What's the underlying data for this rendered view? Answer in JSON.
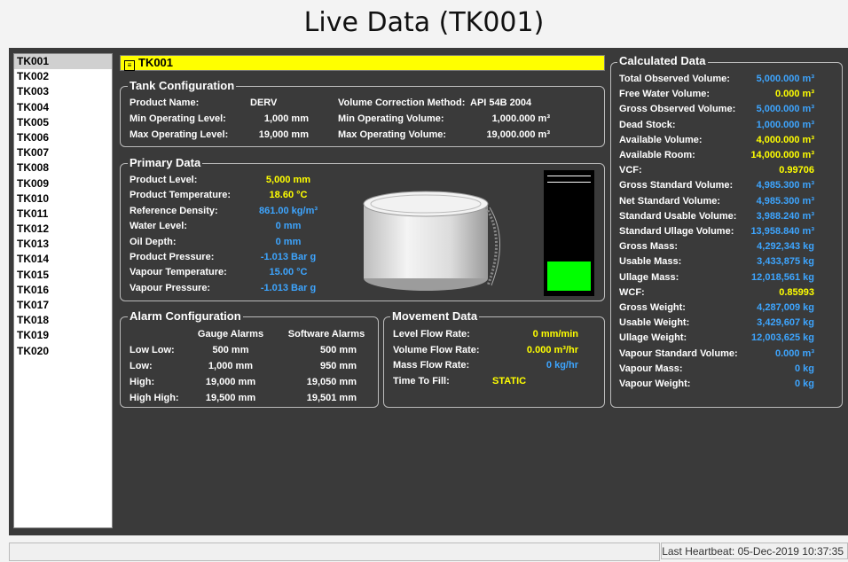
{
  "title": "Live Data (TK001)",
  "tanks": [
    "TK001",
    "TK002",
    "TK003",
    "TK004",
    "TK005",
    "TK006",
    "TK007",
    "TK008",
    "TK009",
    "TK010",
    "TK011",
    "TK012",
    "TK013",
    "TK014",
    "TK015",
    "TK016",
    "TK017",
    "TK018",
    "TK019",
    "TK020"
  ],
  "selected_tank": "TK001",
  "header_tank": "TK001",
  "tank_config": {
    "label": "Tank Configuration",
    "product_name_label": "Product Name:",
    "product_name": "DERV",
    "min_op_level_label": "Min Operating Level:",
    "min_op_level": "1,000 mm",
    "max_op_level_label": "Max Operating Level:",
    "max_op_level": "19,000 mm",
    "vcm_label": "Volume Correction Method:",
    "vcm": "API 54B 2004",
    "min_op_vol_label": "Min Operating Volume:",
    "min_op_vol": "1,000.000 m³",
    "max_op_vol_label": "Max Operating Volume:",
    "max_op_vol": "19,000.000 m³"
  },
  "primary": {
    "label": "Primary Data",
    "rows": [
      {
        "label": "Product Level:",
        "value": "5,000 mm",
        "color": "y"
      },
      {
        "label": "Product Temperature:",
        "value": "18.60 °C",
        "color": "y"
      },
      {
        "label": "Reference Density:",
        "value": "861.00 kg/m³",
        "color": "b"
      },
      {
        "label": "Water Level:",
        "value": "0 mm",
        "color": "b"
      },
      {
        "label": "Oil Depth:",
        "value": "0 mm",
        "color": "b"
      },
      {
        "label": "Product Pressure:",
        "value": "-1.013 Bar g",
        "color": "b"
      },
      {
        "label": "Vapour Temperature:",
        "value": "15.00 °C",
        "color": "b"
      },
      {
        "label": "Vapour Pressure:",
        "value": "-1.013 Bar g",
        "color": "b"
      }
    ],
    "gauge_fill_fraction": 0.25
  },
  "alarm": {
    "label": "Alarm Configuration",
    "gauge_header": "Gauge Alarms",
    "software_header": "Software Alarms",
    "rows": [
      {
        "label": "Low Low:",
        "gauge": "500 mm",
        "software": "500 mm"
      },
      {
        "label": "Low:",
        "gauge": "1,000 mm",
        "software": "950 mm"
      },
      {
        "label": "High:",
        "gauge": "19,000 mm",
        "software": "19,050 mm"
      },
      {
        "label": "High High:",
        "gauge": "19,500 mm",
        "software": "19,501 mm"
      }
    ]
  },
  "movement": {
    "label": "Movement Data",
    "rows": [
      {
        "label": "Level Flow Rate:",
        "value": "0 mm/min",
        "color": "y"
      },
      {
        "label": "Volume Flow Rate:",
        "value": "0.000 m³/hr",
        "color": "y"
      },
      {
        "label": "Mass Flow Rate:",
        "value": "0 kg/hr",
        "color": "b"
      },
      {
        "label": "Time To Fill:",
        "value": "STATIC",
        "color": "y"
      }
    ]
  },
  "calculated": {
    "label": "Calculated Data",
    "rows": [
      {
        "label": "Total Observed Volume:",
        "value": "5,000.000 m³",
        "color": "b"
      },
      {
        "label": "Free Water Volume:",
        "value": "0.000 m³",
        "color": "y"
      },
      {
        "label": "Gross Observed Volume:",
        "value": "5,000.000 m³",
        "color": "b"
      },
      {
        "label": "Dead Stock:",
        "value": "1,000.000 m³",
        "color": "b"
      },
      {
        "label": "Available Volume:",
        "value": "4,000.000 m³",
        "color": "y"
      },
      {
        "label": "Available Room:",
        "value": "14,000.000 m³",
        "color": "y"
      },
      {
        "label": "VCF:",
        "value": "0.99706",
        "color": "y"
      },
      {
        "label": "Gross Standard Volume:",
        "value": "4,985.300 m³",
        "color": "b"
      },
      {
        "label": "Net Standard Volume:",
        "value": "4,985.300 m³",
        "color": "b"
      },
      {
        "label": "Standard Usable Volume:",
        "value": "3,988.240 m³",
        "color": "b"
      },
      {
        "label": "Standard Ullage Volume:",
        "value": "13,958.840 m³",
        "color": "b"
      },
      {
        "label": "Gross Mass:",
        "value": "4,292,343 kg",
        "color": "b"
      },
      {
        "label": "Usable Mass:",
        "value": "3,433,875 kg",
        "color": "b"
      },
      {
        "label": "Ullage Mass:",
        "value": "12,018,561 kg",
        "color": "b"
      },
      {
        "label": "WCF:",
        "value": "0.85993",
        "color": "y"
      },
      {
        "label": "Gross Weight:",
        "value": "4,287,009 kg",
        "color": "b"
      },
      {
        "label": "Usable Weight:",
        "value": "3,429,607 kg",
        "color": "b"
      },
      {
        "label": "Ullage Weight:",
        "value": "12,003,625 kg",
        "color": "b"
      },
      {
        "label": "Vapour Standard Volume:",
        "value": "0.000 m³",
        "color": "b"
      },
      {
        "label": "Vapour Mass:",
        "value": "0 kg",
        "color": "b"
      },
      {
        "label": "Vapour Weight:",
        "value": "0 kg",
        "color": "b"
      }
    ]
  },
  "status": {
    "heartbeat": "Last Heartbeat: 05-Dec-2019 10:37:35"
  },
  "colors": {
    "yellow": "#ffff00",
    "blue": "#3da5ff",
    "panel": "#3a3a3a",
    "gauge_fill": "#00ff00"
  }
}
